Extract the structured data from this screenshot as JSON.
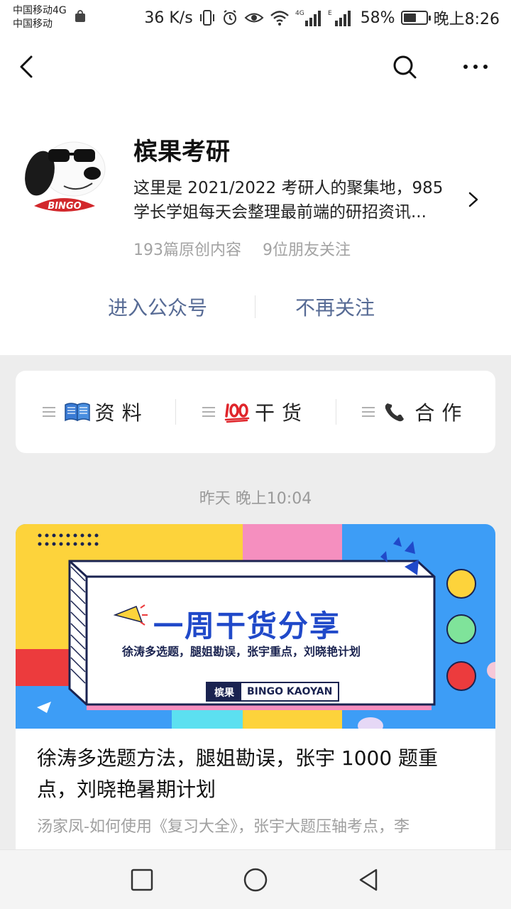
{
  "status_bar": {
    "carrier_1": "中国移动4G",
    "carrier_2": "中国移动",
    "net_speed": "36 K/s",
    "signal_1_label": "4G",
    "signal_2_label": "E",
    "battery_percent": "58%",
    "battery_level": 0.58,
    "time": "晚上8:26"
  },
  "nav": {
    "back_icon": "back-arrow-icon",
    "search_icon": "search-icon",
    "more_icon": "more-icon"
  },
  "account": {
    "name": "槟果考研",
    "avatar_badge": "BINGO",
    "description_line1": "这里是 2021/2022 考研人的聚集地，985",
    "description_line2": "学长学姐每天会整理最前端的研招资讯...",
    "stats": {
      "articles": "193篇原创内容",
      "friends": "9位朋友关注"
    },
    "actions": {
      "enter": "进入公众号",
      "unfollow": "不再关注"
    }
  },
  "menu": {
    "items": [
      {
        "label": "资料",
        "icon": "book-icon"
      },
      {
        "label": "干货",
        "icon": "hundred-points-icon"
      },
      {
        "label": "合作",
        "icon": "telephone-icon"
      }
    ]
  },
  "feed": {
    "timestamp": "昨天 晚上10:04",
    "article": {
      "cover_title": "一周干货分享",
      "cover_subtitle": "徐涛多选题，腿姐勘误，张宇重点，刘晓艳计划",
      "cover_brand_cn": "槟果",
      "cover_brand_en": "BINGO KAOYAN",
      "title": "徐涛多选题方法，腿姐勘误，张宇 1000 题重点，刘晓艳暑期计划",
      "digest": "汤家凤-如何使用《复习大全》，张宇大题压轴考点，李"
    }
  },
  "colors": {
    "link_blue": "#576b95",
    "cover_yellow": "#fdd33b",
    "cover_pink": "#f58fbf",
    "cover_blue": "#3d9df6",
    "cover_red": "#ec3b3d"
  }
}
